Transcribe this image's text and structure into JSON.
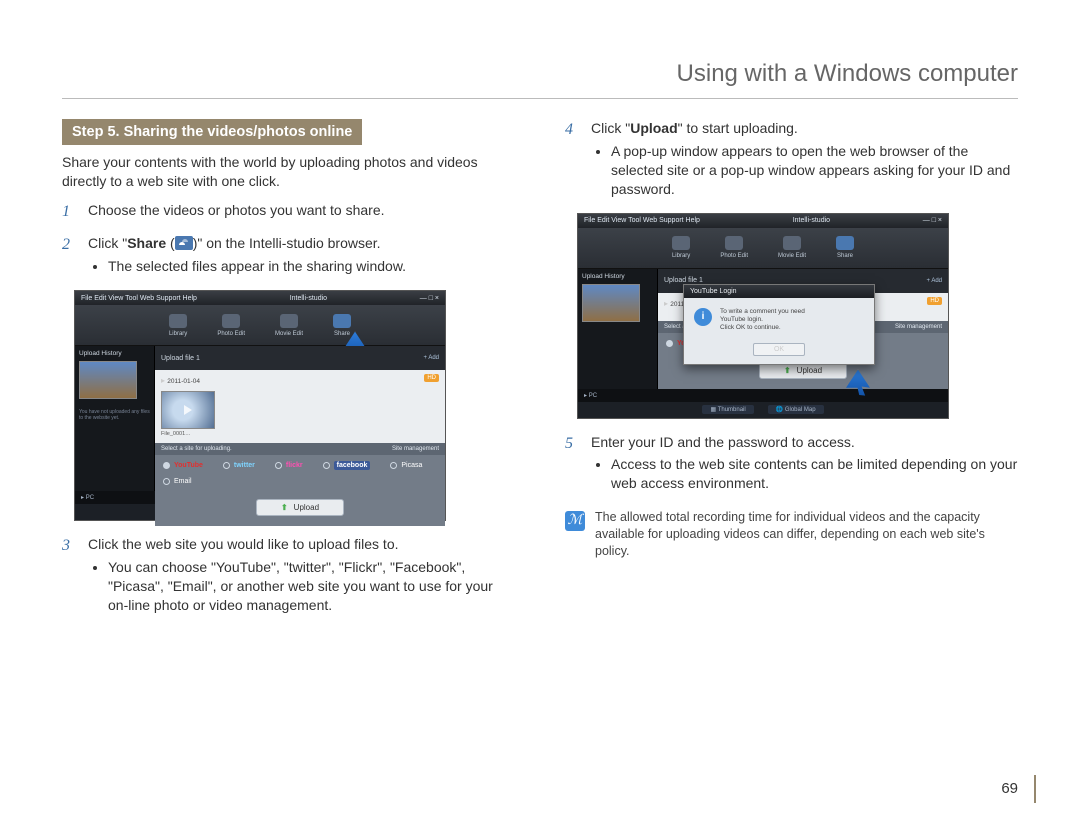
{
  "page": {
    "title": "Using with a Windows computer",
    "number": "69"
  },
  "header": {
    "step_title": "Step 5. Sharing the videos/photos online"
  },
  "intro": "Share your contents with the world by uploading photos and videos directly to a web site with one click.",
  "steps": {
    "s1": {
      "num": "1",
      "text": "Choose the videos or photos you want to share."
    },
    "s2": {
      "num": "2",
      "pre": "Click \"",
      "bold": "Share",
      "mid": " (",
      "post": ")\" on the Intelli-studio browser.",
      "sub1": "The selected files appear in the sharing window."
    },
    "s3": {
      "num": "3",
      "text": "Click the web site you would like to upload files to.",
      "sub1": "You can choose \"YouTube\", \"twitter\", \"Flickr\", \"Facebook\", \"Picasa\", \"Email\", or another web site you want to use for your on-line photo or video management."
    },
    "s4": {
      "num": "4",
      "pre": "Click \"",
      "bold": "Upload",
      "post": "\" to start uploading.",
      "sub1": "A pop-up window appears to open the web browser of the selected site or a pop-up window appears asking for your ID and password."
    },
    "s5": {
      "num": "5",
      "text": "Enter your ID and the password to access.",
      "sub1": "Access to the web site contents can be limited depending on your web access environment."
    }
  },
  "note": "The allowed total recording time for individual videos and the capacity available for uploading videos can differ, depending on each web site's policy.",
  "shot": {
    "app_title_left": "File   Edit   View   Tool   Web Support   Help",
    "app_title_center": "Intelli-studio",
    "toolbar": {
      "t1": "Library",
      "t2": "Photo Edit",
      "t3": "Movie Edit",
      "t4": "Share"
    },
    "side_title": "Upload History",
    "side_note": "You have not uploaded any files to the website yet.",
    "main_head": "Upload file 1",
    "add": "+ Add",
    "date_prefix": "▸",
    "date": "2011-01-04",
    "hd": "HD",
    "thumb_label": "File_0001…",
    "sites_head": "Select a site for uploading.",
    "sites_mgmt": "Site management",
    "site_youtube": "YouTube",
    "site_twitter": "twitter",
    "site_flickr": "flickr",
    "site_facebook": "facebook",
    "site_picasa": "Picasa",
    "site_email": "Email",
    "upload_btn": "Upload",
    "foot_thumb": "Thumbnail",
    "foot_map": "Global Map",
    "pc": "PC",
    "popup_title": "YouTube Login",
    "popup_line1": "To write a comment you need",
    "popup_line2": "YouTube login.",
    "popup_line3": "Click OK to continue.",
    "popup_ok": "OK"
  }
}
